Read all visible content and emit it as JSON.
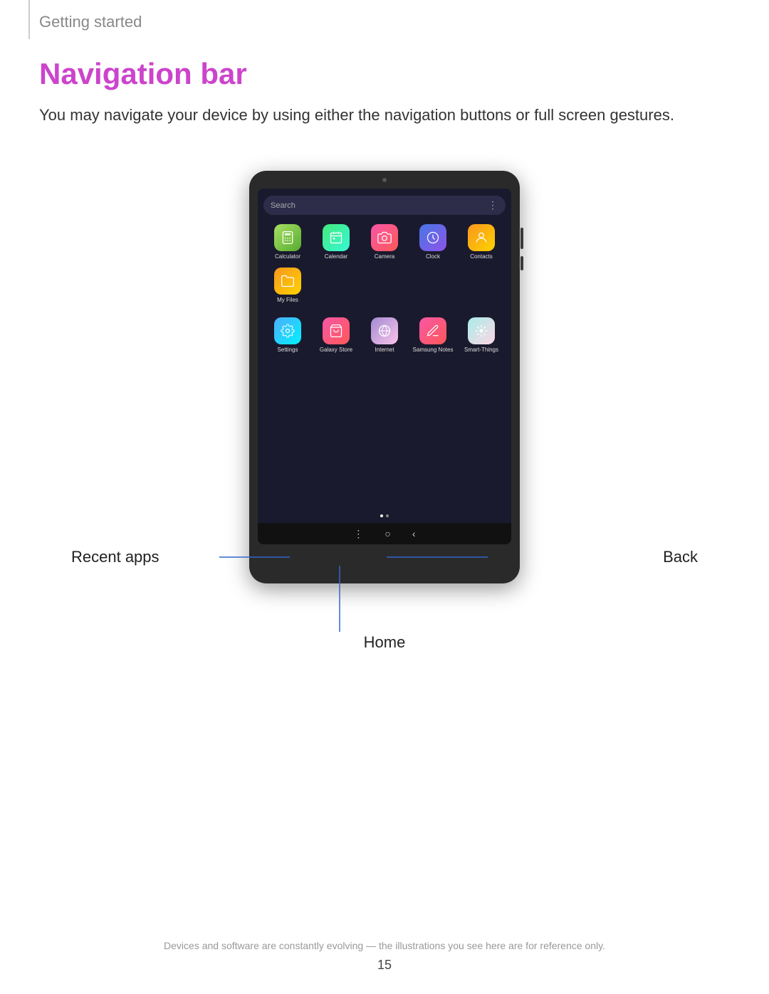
{
  "breadcrumb": "Getting started",
  "page_title": "Navigation bar",
  "description": "You may navigate your device by using either the navigation buttons or full screen gestures.",
  "tablet": {
    "search_placeholder": "Search",
    "apps_row1": [
      {
        "id": "calculator",
        "label": "Calculator",
        "icon": "🧮",
        "icon_class": "icon-calculator"
      },
      {
        "id": "calendar",
        "label": "Calendar",
        "icon": "📅",
        "icon_class": "icon-calendar"
      },
      {
        "id": "camera",
        "label": "Camera",
        "icon": "📷",
        "icon_class": "icon-camera"
      },
      {
        "id": "clock",
        "label": "Clock",
        "icon": "🕐",
        "icon_class": "icon-clock"
      },
      {
        "id": "contacts",
        "label": "Contacts",
        "icon": "👤",
        "icon_class": "icon-contacts"
      },
      {
        "id": "myfiles",
        "label": "My Files",
        "icon": "📁",
        "icon_class": "icon-myfiles"
      }
    ],
    "apps_row2": [
      {
        "id": "settings",
        "label": "Settings",
        "icon": "⚙",
        "icon_class": "icon-settings"
      },
      {
        "id": "galaxystore",
        "label": "Galaxy Store",
        "icon": "🛍",
        "icon_class": "icon-galaxystore"
      },
      {
        "id": "internet",
        "label": "Internet",
        "icon": "🌐",
        "icon_class": "icon-internet"
      },
      {
        "id": "samsungnotes",
        "label": "Samsung Notes",
        "icon": "📝",
        "icon_class": "icon-samsungnotes"
      },
      {
        "id": "smartthings",
        "label": "Smart-Things",
        "icon": "✨",
        "icon_class": "icon-smartthings"
      }
    ]
  },
  "labels": {
    "recent_apps": "Recent apps",
    "home": "Home",
    "back": "Back"
  },
  "footer": {
    "note": "Devices and software are constantly evolving — the illustrations you see here are for reference only.",
    "page_number": "15"
  }
}
